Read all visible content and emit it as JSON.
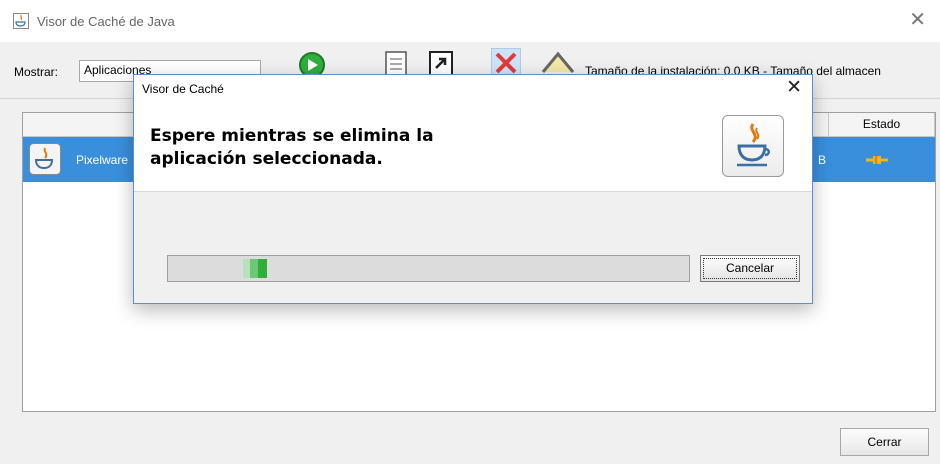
{
  "window": {
    "title": "Visor de Caché de Java"
  },
  "toolbar": {
    "show_label": "Mostrar:",
    "show_selected": "Aplicaciones",
    "size_info": "Tamaño de la instalación:  0.0 KB - Tamaño del almacen"
  },
  "table": {
    "status_header": "Estado",
    "row": {
      "name": "Pixelware",
      "size_fragment": "B"
    }
  },
  "footer": {
    "close_label": "Cerrar"
  },
  "dialog": {
    "title": "Visor de Caché",
    "message_line1": "Espere mientras se elimina la",
    "message_line2": "aplicación seleccionada.",
    "cancel_label": "Cancelar",
    "progress_mode": "indeterminate"
  },
  "colors": {
    "selection": "#3a8fdd",
    "progress": "#2fae3c",
    "accent": "#e07a10"
  }
}
